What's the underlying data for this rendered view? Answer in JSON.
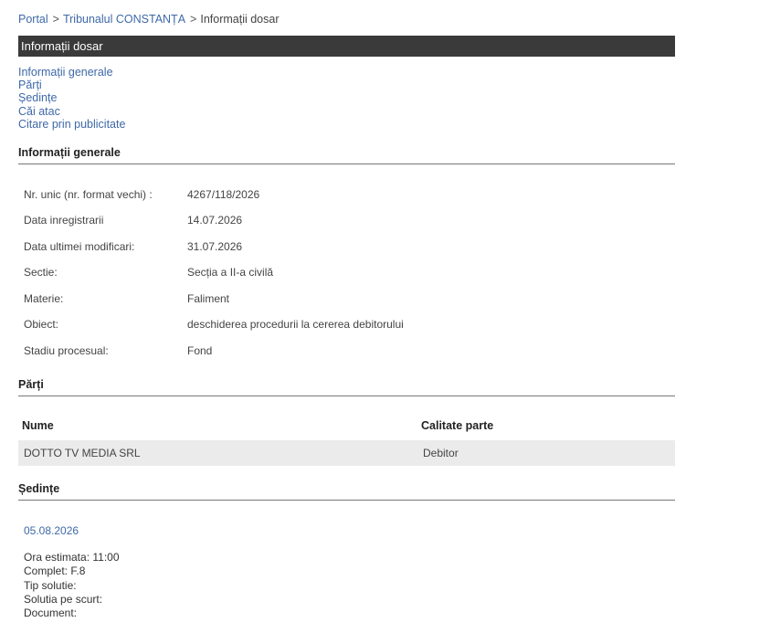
{
  "breadcrumb": {
    "items": [
      "Portal",
      "Tribunalul CONSTANȚA"
    ],
    "separator": ">",
    "current": "Informații dosar"
  },
  "title_bar": {
    "title": "Informații dosar"
  },
  "toc": {
    "links": [
      "Informații generale",
      "Părți",
      "Ședințe",
      "Căi atac",
      "Citare prin publicitate"
    ]
  },
  "general_info": {
    "heading": "Informații generale",
    "rows": [
      {
        "label": "Nr. unic (nr. format vechi) :",
        "value": "4267/118/2026"
      },
      {
        "label": "Data inregistrarii",
        "value": "14.07.2026"
      },
      {
        "label": "Data ultimei modificari:",
        "value": "31.07.2026"
      },
      {
        "label": "Sectie:",
        "value": "Secția a II-a civilă"
      },
      {
        "label": "Materie:",
        "value": "Faliment"
      },
      {
        "label": "Obiect:",
        "value": "deschiderea procedurii la cererea debitorului"
      },
      {
        "label": "Stadiu procesual:",
        "value": "Fond"
      }
    ]
  },
  "parti": {
    "heading": "Părți",
    "columns": [
      "Nume",
      "Calitate parte"
    ],
    "rows": [
      {
        "name": "DOTTO TV MEDIA SRL",
        "role": "Debitor"
      }
    ]
  },
  "sedinte": {
    "heading": "Ședințe",
    "date": "05.08.2026",
    "details": [
      {
        "label": "Ora estimata:",
        "value": "11:00"
      },
      {
        "label": "Complet:",
        "value": "F.8"
      },
      {
        "label": "Tip solutie:",
        "value": ""
      },
      {
        "label": "Solutia pe scurt:",
        "value": ""
      },
      {
        "label": "Document:",
        "value": ""
      }
    ]
  }
}
